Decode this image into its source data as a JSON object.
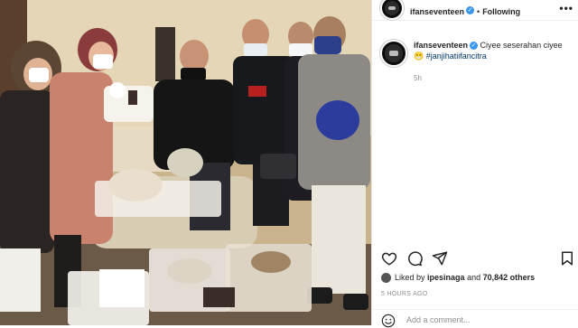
{
  "post": {
    "username": "ifanseventeen",
    "verified_mark": "✓",
    "separator": "•",
    "follow_status": "Following",
    "more_icon": "more-horizontal-icon",
    "photo_alt": "Group photo with wedding seserahan gifts"
  },
  "caption": {
    "username": "ifanseventeen",
    "text": "Ciyee seserahan ciyee 😁",
    "hashtag": "#janjihatiifancitra",
    "time": "5h"
  },
  "actions": {
    "like_icon": "heart-icon",
    "comment_icon": "comment-icon",
    "share_icon": "send-icon",
    "save_icon": "bookmark-icon"
  },
  "likes": {
    "prefix": "Liked by",
    "first_user": "ipesinaga",
    "connector": "and",
    "count": "70,842 others"
  },
  "timestamp": "5 HOURS AGO",
  "comment": {
    "placeholder": "Add a comment..."
  }
}
